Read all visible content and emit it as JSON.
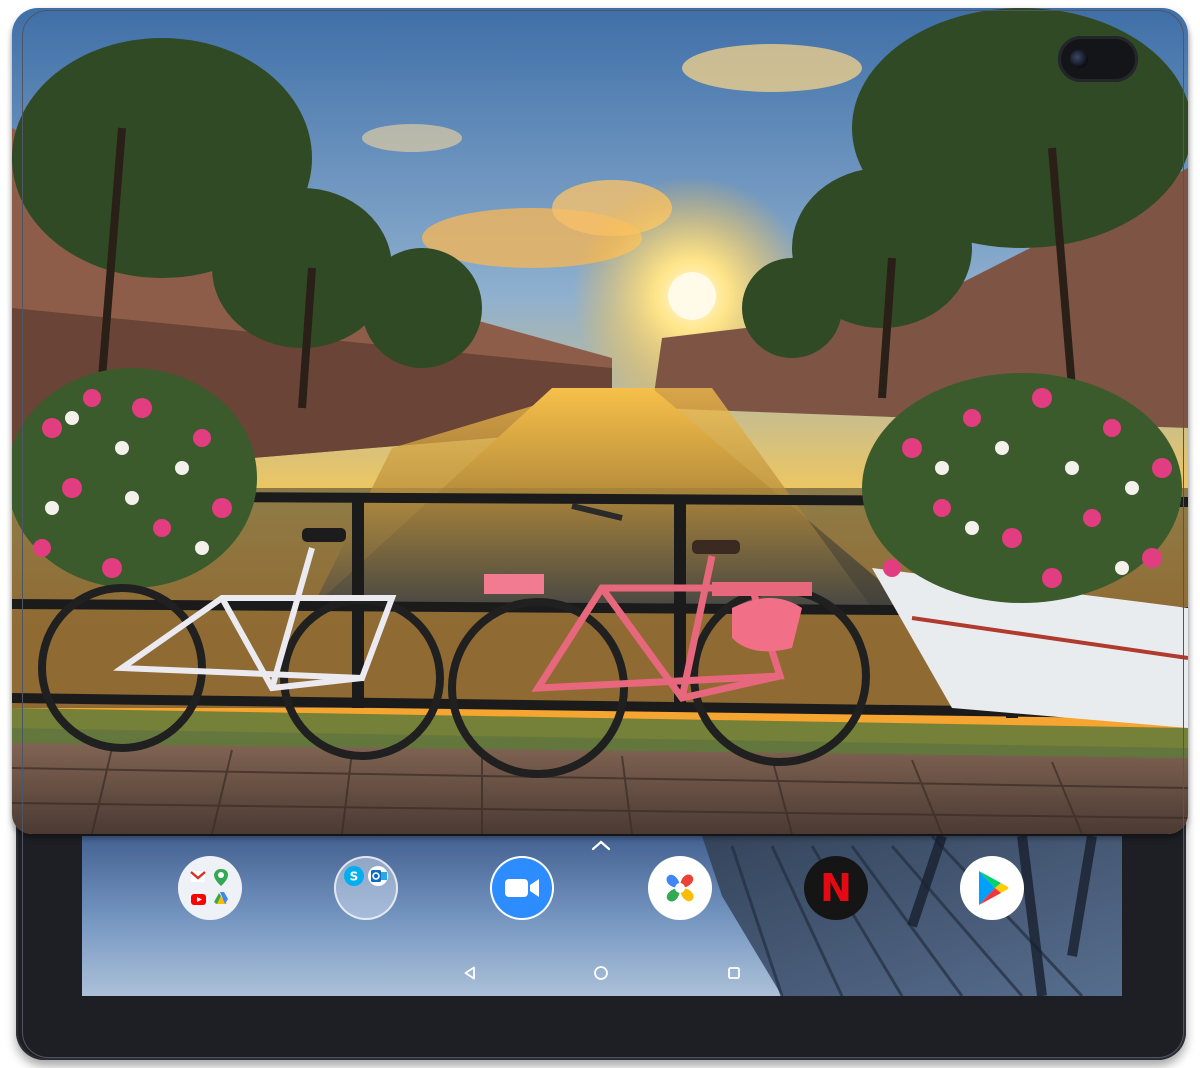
{
  "device": {
    "cover_art": "amsterdam-canal-bicycles-sunset",
    "colors": {
      "frame": "#1d1f24",
      "screen_sky": "#6d8fb9"
    }
  },
  "home_screen": {
    "app_drawer_handle": "chevron-up-icon",
    "dock": [
      {
        "id": "google-apps-folder",
        "icons": [
          "gmail-icon",
          "maps-icon",
          "youtube-icon",
          "drive-icon"
        ]
      },
      {
        "id": "skype-outlook-folder",
        "icons": [
          "skype-icon",
          "outlook-icon"
        ]
      },
      {
        "id": "zoom-app",
        "icon": "zoom-video-icon",
        "color": "#2d8cff"
      },
      {
        "id": "photos-app",
        "icon": "pinwheel-icon"
      },
      {
        "id": "netflix-app",
        "icon": "netflix-icon",
        "letter": "N",
        "color": "#e50914"
      },
      {
        "id": "play-store-app",
        "icon": "play-store-icon"
      }
    ]
  },
  "navigation": {
    "buttons": [
      "back-icon",
      "home-icon",
      "recents-icon"
    ]
  }
}
